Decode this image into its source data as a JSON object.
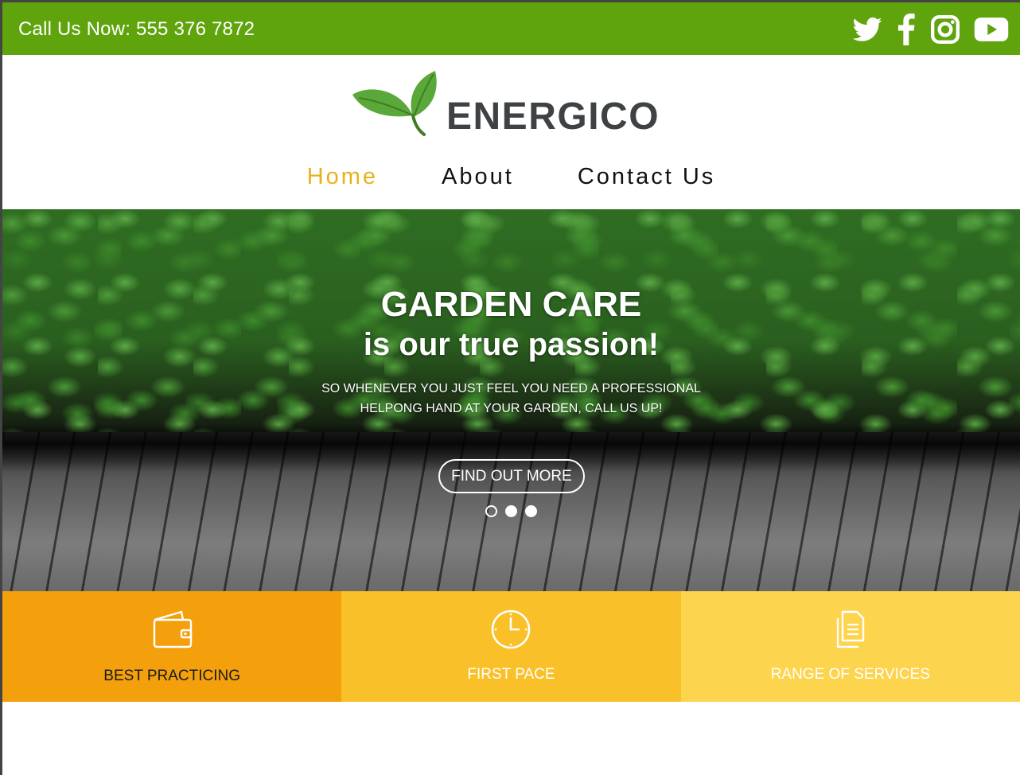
{
  "topbar": {
    "phone": "Call Us Now: 555 376 7872",
    "social": [
      "twitter-icon",
      "facebook-icon",
      "instagram-icon",
      "youtube-icon"
    ],
    "background": "#5fa40d"
  },
  "header": {
    "logo_text": "ENERGICO",
    "nav": [
      {
        "label": "Home",
        "active": true
      },
      {
        "label": "About",
        "active": false
      },
      {
        "label": "Contact Us",
        "active": false
      }
    ]
  },
  "hero": {
    "title": "GARDEN CARE",
    "subtitle": "is our true passion!",
    "text_line1": "SO WHENEVER YOU JUST FEEL YOU NEED A PROFESSIONAL",
    "text_line2": "HELPONG HAND AT YOUR GARDEN, CALL US UP!",
    "cta": "FIND OUT MORE",
    "slides": 3,
    "active_slide": 1
  },
  "features": [
    {
      "label": "BEST PRACTICING",
      "icon": "wallet-icon",
      "color": "#f4a00c"
    },
    {
      "label": "FIRST PACE",
      "icon": "clock-icon",
      "color": "#fac029"
    },
    {
      "label": "RANGE OF SERVICES",
      "icon": "documents-icon",
      "color": "#fdd44d"
    }
  ],
  "colors": {
    "accent_green": "#5fa40d",
    "nav_active": "#e6b21c"
  }
}
